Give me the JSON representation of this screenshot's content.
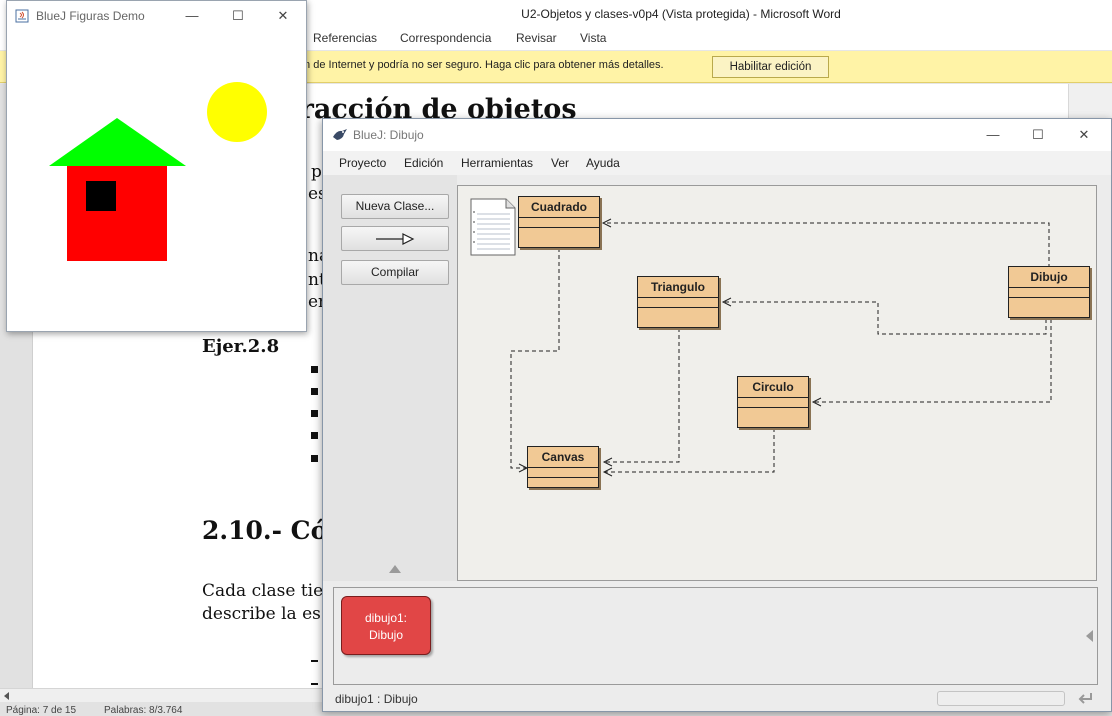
{
  "word": {
    "title": "U2-Objetos y clases-v0p4 (Vista protegida)  -  Microsoft Word",
    "tabs": [
      "Referencias",
      "Correspondencia",
      "Revisar",
      "Vista"
    ],
    "warning_text": "ción de Internet y podría no ser seguro. Haga clic para obtener más detalles.",
    "enable_button": "Habilitar edición",
    "heading": "teracción de objetos",
    "ejer": "Ejer.2.8",
    "section_heading": "2.10.- Có",
    "para_line1": "Cada clase tie",
    "para_line2": "describe la es",
    "fragments": [
      "p",
      "es",
      "na",
      "nt",
      "en"
    ],
    "status_pages": "Página: 7 de 15",
    "status_words": "Palabras: 8/3.764"
  },
  "figuras": {
    "title": "BlueJ Figuras Demo",
    "colors": {
      "sun": "#ffff00",
      "roof": "#00ff00",
      "wall": "#ff0000",
      "window": "#000000"
    }
  },
  "bluej": {
    "title": "BlueJ: Dibujo",
    "menu": [
      "Proyecto",
      "Edición",
      "Herramientas",
      "Ver",
      "Ayuda"
    ],
    "buttons": {
      "new_class": "Nueva Clase...",
      "compile": "Compilar"
    },
    "classes": [
      "Cuadrado",
      "Triangulo",
      "Dibujo",
      "Circulo",
      "Canvas"
    ],
    "object": {
      "line1": "dibujo1:",
      "line2": "Dibujo"
    },
    "status": "dibujo1 : Dibujo"
  },
  "window_controls": {
    "minimize": "—",
    "maximize": "☐",
    "close": "✕"
  }
}
